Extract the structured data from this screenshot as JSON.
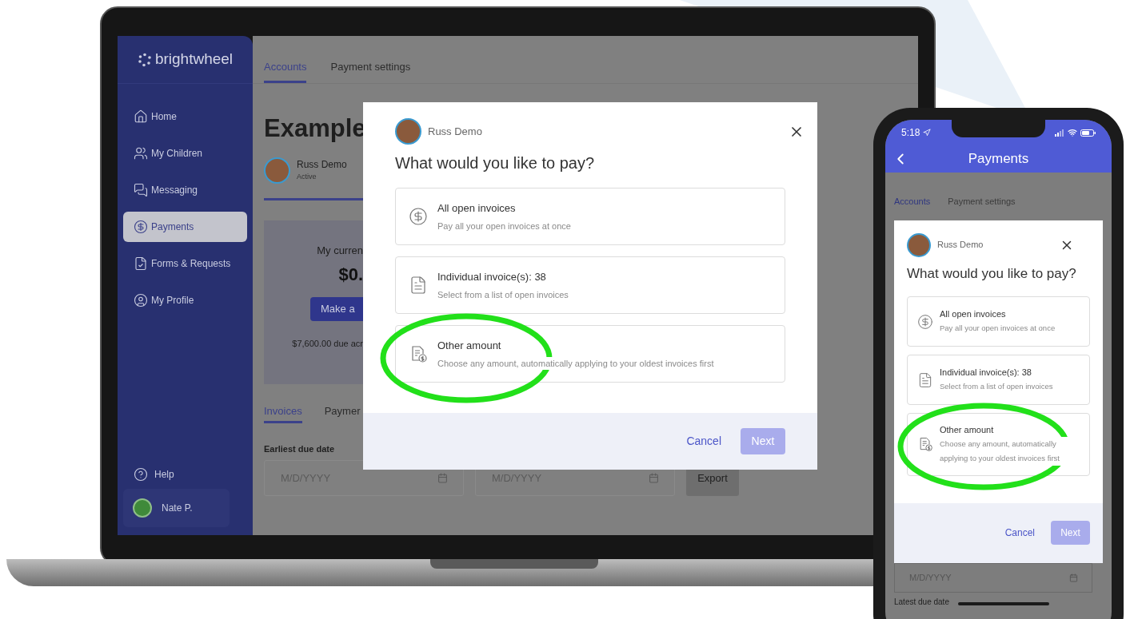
{
  "laptop": {
    "sidebar": {
      "logo": "brightwheel",
      "items": [
        {
          "kind": "home",
          "label": "Home",
          "selected": false
        },
        {
          "kind": "children",
          "label": "My Children",
          "selected": false
        },
        {
          "kind": "messaging",
          "label": "Messaging",
          "selected": false
        },
        {
          "kind": "payments",
          "label": "Payments",
          "selected": true
        },
        {
          "kind": "forms",
          "label": "Forms & Requests",
          "selected": false
        },
        {
          "kind": "profile",
          "label": "My Profile",
          "selected": false
        }
      ],
      "help": "Help",
      "user": "Nate P."
    },
    "tabs": [
      {
        "label": "Accounts",
        "selected": true
      },
      {
        "label": "Payment settings",
        "selected": false
      }
    ],
    "heading": "Example",
    "student": {
      "name": "Russ Demo",
      "status": "Active"
    },
    "balance": {
      "label": "My curren",
      "amount": "$0.",
      "button": "Make a",
      "due": "$7,600.00 due acr"
    },
    "sub_tabs": [
      {
        "label": "Invoices",
        "selected": true
      },
      {
        "label": "Paymer",
        "selected": false
      }
    ],
    "filters": {
      "label": "Earliest due date",
      "fields": [
        {
          "placeholder": "M/D/YYYY"
        },
        {
          "placeholder": "M/D/YYYY"
        }
      ],
      "export": "Export"
    },
    "modal": {
      "student": "Russ Demo",
      "title": "What would you like to pay?",
      "options": [
        {
          "kind": "dollar",
          "title": "All open invoices",
          "description": "Pay all your open invoices at once",
          "highlighted": false
        },
        {
          "kind": "invoice",
          "title": "Individual invoice(s): 38",
          "description": "Select from a list of open invoices",
          "highlighted": false
        },
        {
          "kind": "invoice-dollar",
          "title": "Other amount",
          "description": "Choose any amount, automatically applying to your oldest invoices first",
          "highlighted": true
        }
      ],
      "cancel": "Cancel",
      "next": {
        "label": "Next",
        "disabled": true
      }
    }
  },
  "phone": {
    "time": "5:18",
    "title": "Payments",
    "tabs": [
      {
        "label": "Accounts",
        "selected": true
      },
      {
        "label": "Payment settings",
        "selected": false
      }
    ],
    "modal": {
      "student": "Russ Demo",
      "title": "What would you like to pay?",
      "options": [
        {
          "kind": "dollar",
          "title": "All open invoices",
          "description": "Pay all your open invoices at once",
          "highlighted": false
        },
        {
          "kind": "invoice",
          "title": "Individual invoice(s): 38",
          "description": "Select from a list of open invoices",
          "highlighted": false
        },
        {
          "kind": "invoice-dollar",
          "title": "Other amount",
          "description": "Choose any amount, automatically applying to your oldest invoices first",
          "highlighted": true
        }
      ],
      "cancel": "Cancel",
      "next": {
        "label": "Next",
        "disabled": true
      }
    },
    "date_field": {
      "placeholder": "M/D/YYYY"
    },
    "date_label": "Latest due date"
  }
}
